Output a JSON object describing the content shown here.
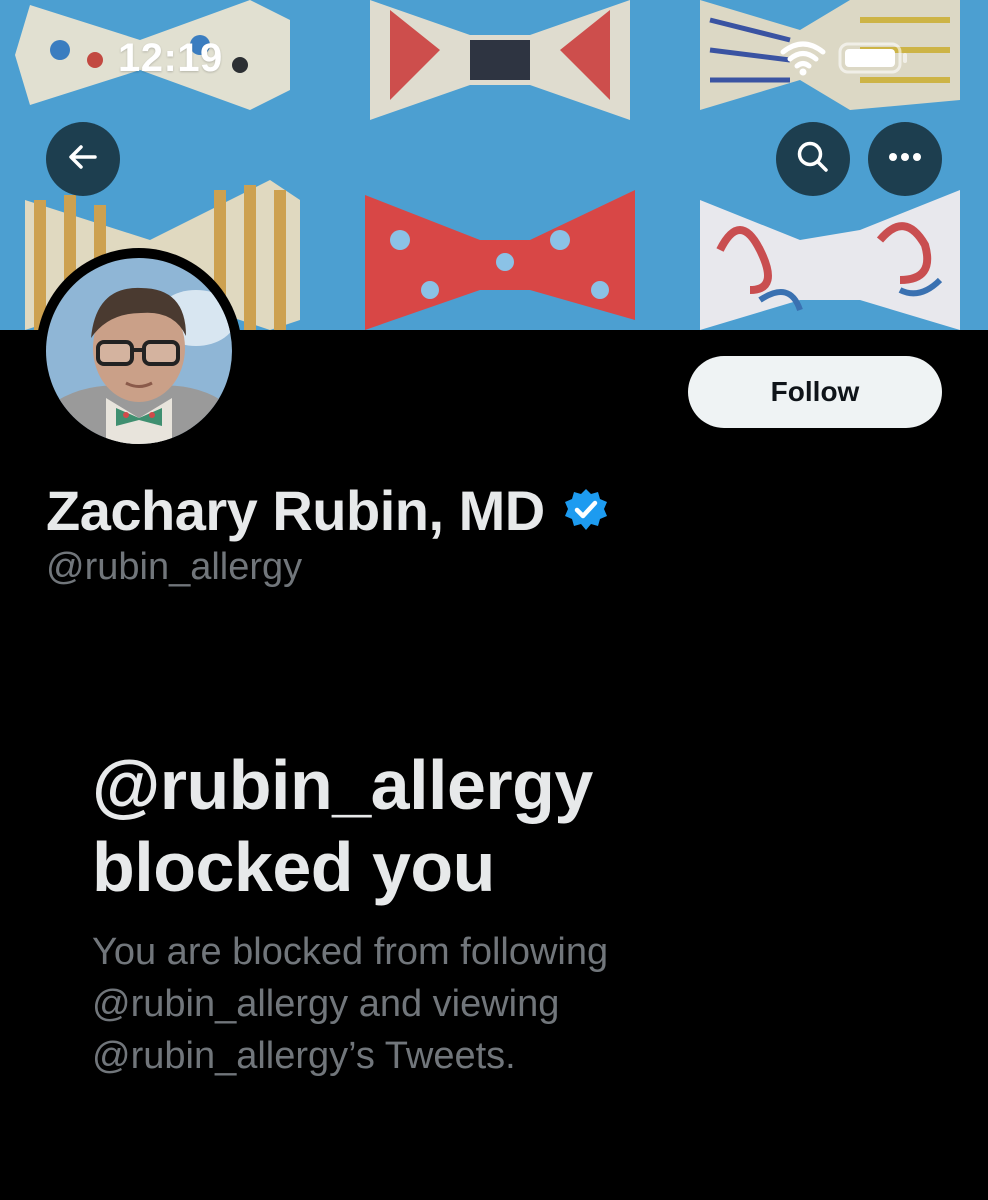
{
  "status_bar": {
    "time": "12:19",
    "wifi_icon": "wifi-icon",
    "battery_icon": "battery-icon"
  },
  "header": {
    "back_icon": "arrow-left-icon",
    "search_icon": "search-icon",
    "more_icon": "more-horizontal-icon"
  },
  "profile": {
    "name": "Zachary Rubin, MD",
    "handle": "@rubin_allergy",
    "verified_icon": "verified-badge-icon",
    "follow_label": "Follow"
  },
  "blocked_notice": {
    "title": "@rubin_allergy blocked you",
    "description": "You are blocked from following @rubin_allergy and viewing @rubin_allergy’s Tweets."
  },
  "colors": {
    "background": "#000000",
    "banner": "#4c9fd1",
    "verified": "#1d9bf0",
    "follow_button_bg": "#eff3f4",
    "secondary_text": "#71767b",
    "primary_text": "#e7e9ea"
  }
}
